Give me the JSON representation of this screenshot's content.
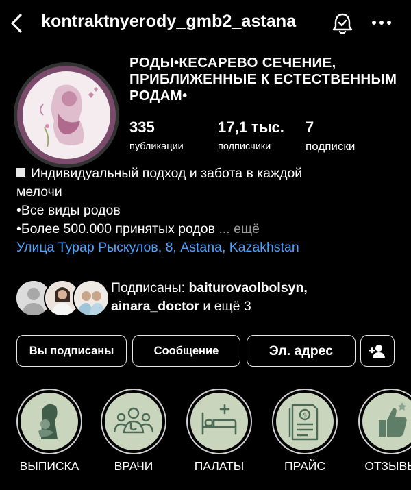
{
  "header": {
    "username": "kontraktnyerody_gmb2_astana",
    "icons": [
      "back-arrow-icon",
      "bell-check-icon",
      "more-horizontal-icon"
    ]
  },
  "profile": {
    "category_title": "РОДЫ•КЕСАРЕВО СЕЧЕНИЕ, ПРИБЛИЖЕННЫЕ К ЕСТЕСТВЕННЫМ РОДАМ•",
    "stats": [
      {
        "value": "335",
        "label": "публикации"
      },
      {
        "value": "17,1 тыс.",
        "label": "подписчики"
      },
      {
        "value": "7",
        "label": "подписки"
      }
    ],
    "bio_lines": [
      "Индивидуальный подход и забота в каждой",
      "мелочи",
      "•Все виды родов",
      "•Более 500.000 принятых родов"
    ],
    "bio_more": "... ещё",
    "location": "Улица Турар Рыскулов, 8, Astana, Kazakhstan"
  },
  "followed_by": {
    "prefix": "Подписаны:",
    "user1": "baiturovaolbolsyn,",
    "user2": "ainara_doctor",
    "suffix": "и ещё 3"
  },
  "buttons": {
    "following": "Вы подписаны",
    "message": "Сообщение",
    "email": "Эл. адрес"
  },
  "highlights": [
    {
      "label": "ВЫПИСКА",
      "icon": "mother-baby-icon"
    },
    {
      "label": "ВРАЧИ",
      "icon": "doctors-icon"
    },
    {
      "label": "ПАЛАТЫ",
      "icon": "hospital-bed-icon"
    },
    {
      "label": "ПРАЙС",
      "icon": "price-document-icon"
    },
    {
      "label": "ОТЗЫВЫ",
      "icon": "thumbs-up-icon"
    }
  ],
  "colors": {
    "background": "#000000",
    "link": "#4ea3ff",
    "highlight_fill": "#c9d5bd",
    "avatar_bg": "#7a4b6a"
  }
}
